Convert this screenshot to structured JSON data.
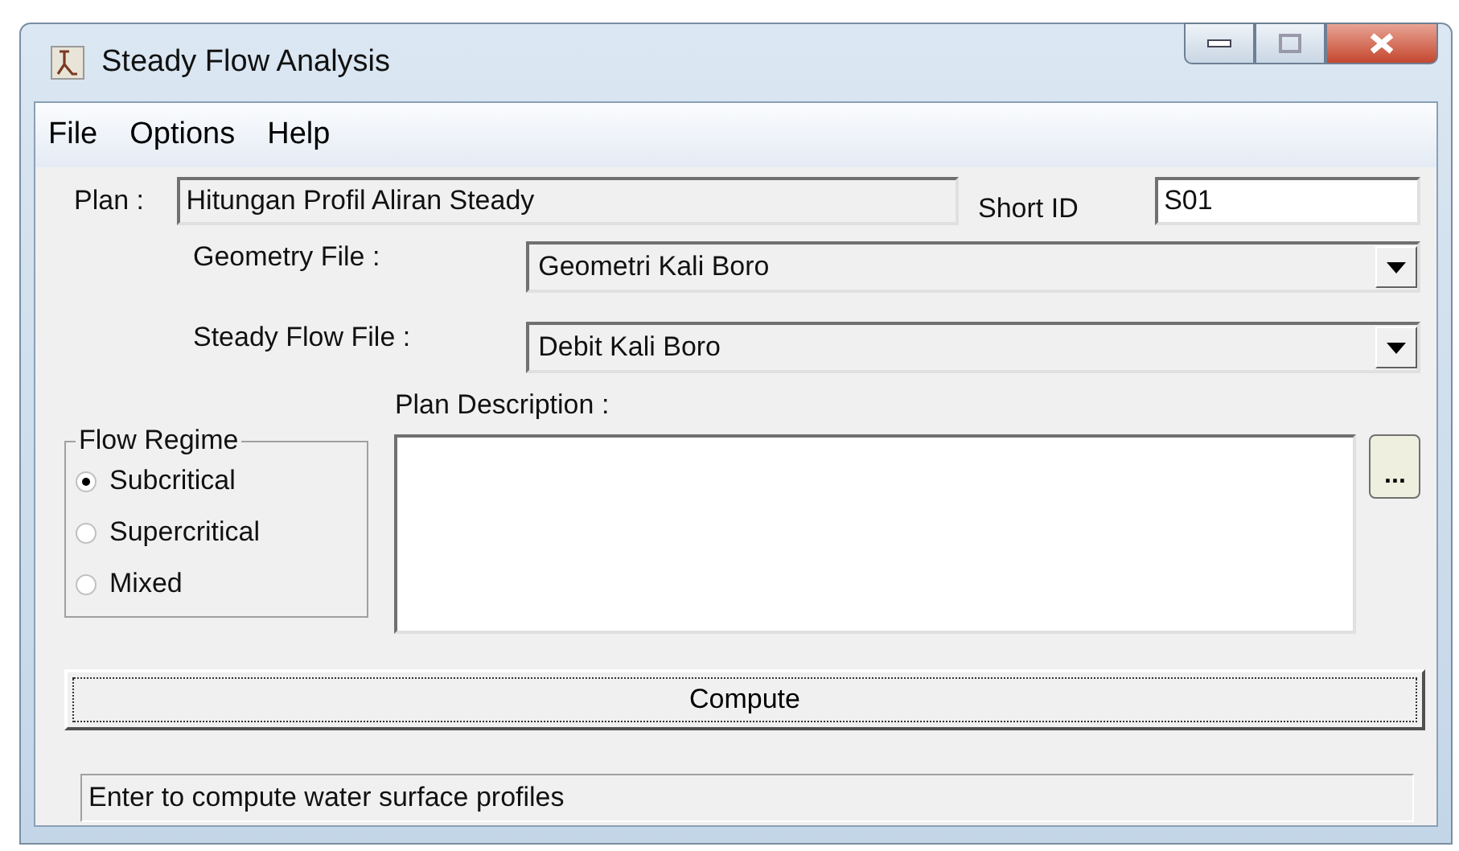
{
  "window": {
    "title": "Steady Flow Analysis"
  },
  "menu": [
    "File",
    "Options",
    "Help"
  ],
  "plan": {
    "label": "Plan :",
    "value": "Hitungan Profil Aliran Steady"
  },
  "short_id": {
    "label": "Short ID",
    "value": "S01"
  },
  "geometry_file": {
    "label": "Geometry File :",
    "value": "Geometri Kali Boro"
  },
  "steady_flow_file": {
    "label": "Steady Flow File :",
    "value": "Debit Kali Boro"
  },
  "flow_regime": {
    "title": "Flow Regime",
    "options": [
      {
        "label": "Subcritical",
        "selected": true
      },
      {
        "label": "Supercritical",
        "selected": false
      },
      {
        "label": "Mixed",
        "selected": false
      }
    ]
  },
  "plan_description": {
    "label": "Plan Description :"
  },
  "browse_button": "...",
  "compute_button": "Compute",
  "status_bar": "Enter to compute water surface profiles"
}
